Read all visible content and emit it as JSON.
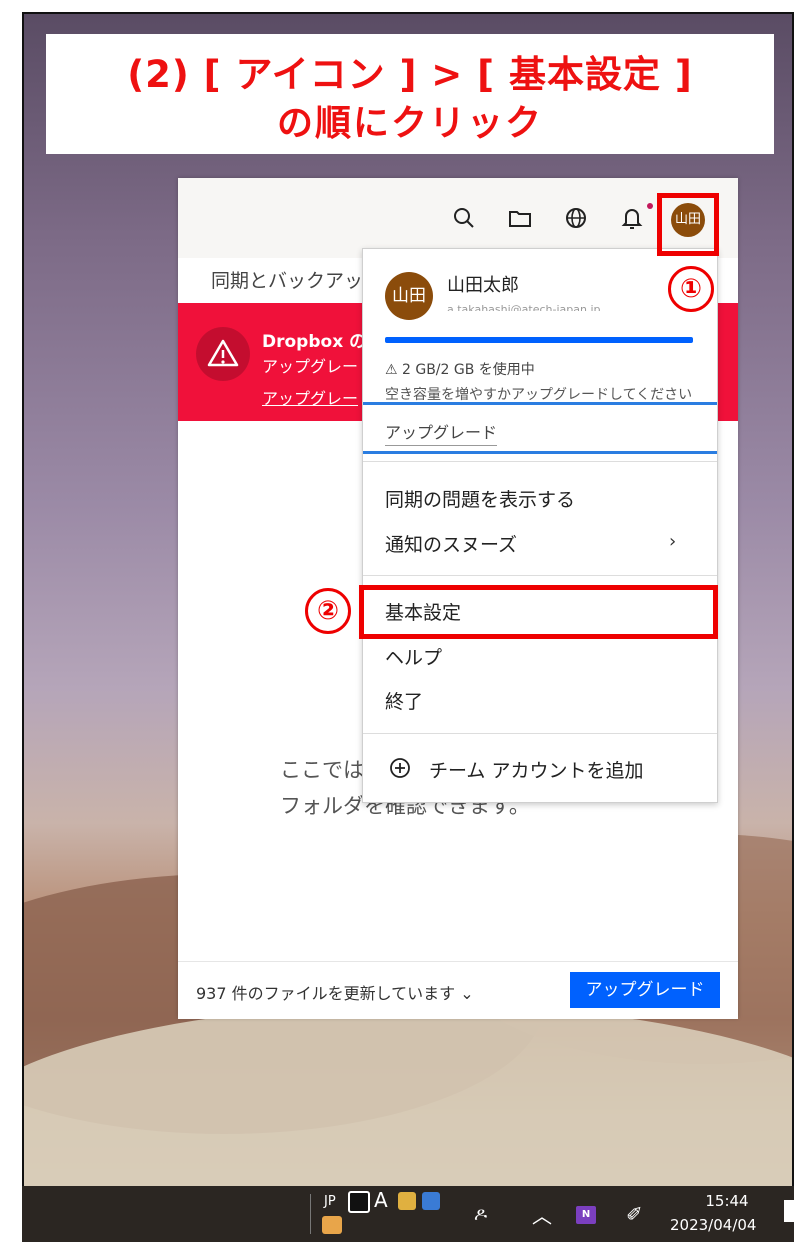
{
  "banner": {
    "line1": "(2) [ アイコン ] > [ 基本設定 ]",
    "line2": "の順にクリック"
  },
  "app": {
    "sync_title": "同期とバックアッ",
    "alert": {
      "title": "Dropbox の",
      "body": "アップグレー",
      "link": "アップグレー"
    },
    "empty_line1": "ここでは",
    "empty_line2": "フォルダを確認できます。",
    "footer_status": "937 件のファイルを更新しています ⌄",
    "footer_button": "アップグレード",
    "avatar_initials": "山田",
    "icons": [
      "search-icon",
      "folder-icon",
      "globe-icon",
      "bell-icon"
    ]
  },
  "menu": {
    "avatar_initials": "山田",
    "user_name": "山田太郎",
    "email": "a.takahashi@atech-japan.jp",
    "usage_fraction": 1.0,
    "storage_warning": "⚠ 2 GB/2 GB を使用中",
    "free_up_text": "空き容量を増やすかアップグレードしてください",
    "upgrade_link": "アップグレード",
    "items": {
      "sync_issues": "同期の問題を表示する",
      "snooze": "通知のスヌーズ",
      "preferences": "基本設定",
      "help": "ヘルプ",
      "quit": "終了",
      "add_team": "チーム アカウントを追加"
    }
  },
  "annotations": {
    "step1": "①",
    "step2": "②",
    "highlight_color": "#ee0000"
  },
  "taskbar": {
    "ime": "JP",
    "ime_mode": "A",
    "time": "15:44",
    "date": "2023/04/04"
  }
}
